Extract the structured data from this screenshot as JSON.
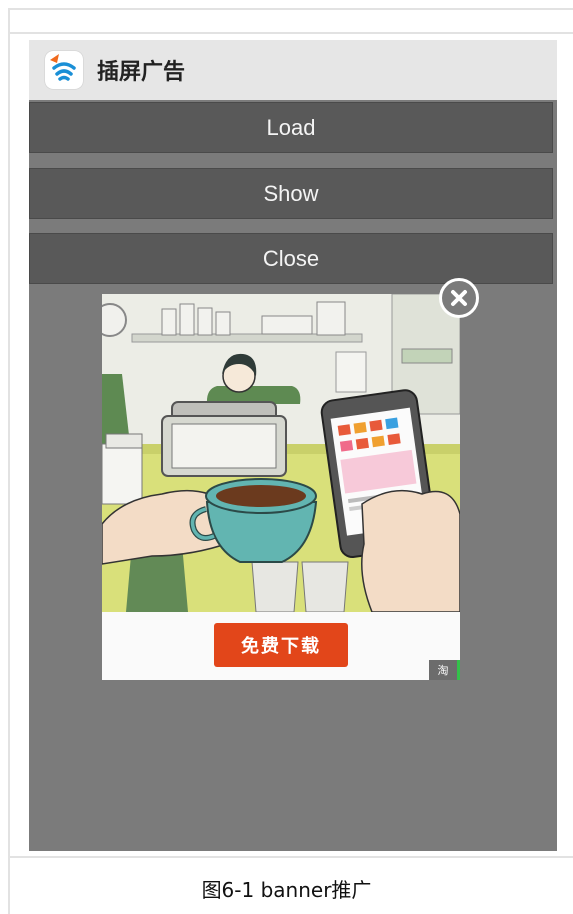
{
  "app": {
    "title": "插屏广告",
    "icon": "app-wifi-logo-icon"
  },
  "buttons": {
    "load": "Load",
    "show": "Show",
    "close": "Close"
  },
  "ad": {
    "cta_label": "免费下载",
    "badge_text": "淘",
    "close_icon": "close-icon",
    "illustration": "coffee-cup-and-smartphone-illustration"
  },
  "caption": "图6-1 banner推广",
  "colors": {
    "screen_bg": "#7b7b7b",
    "button_bg": "#595959",
    "titlebar_bg": "#e6e6e6",
    "cta_bg": "#e2461a"
  }
}
